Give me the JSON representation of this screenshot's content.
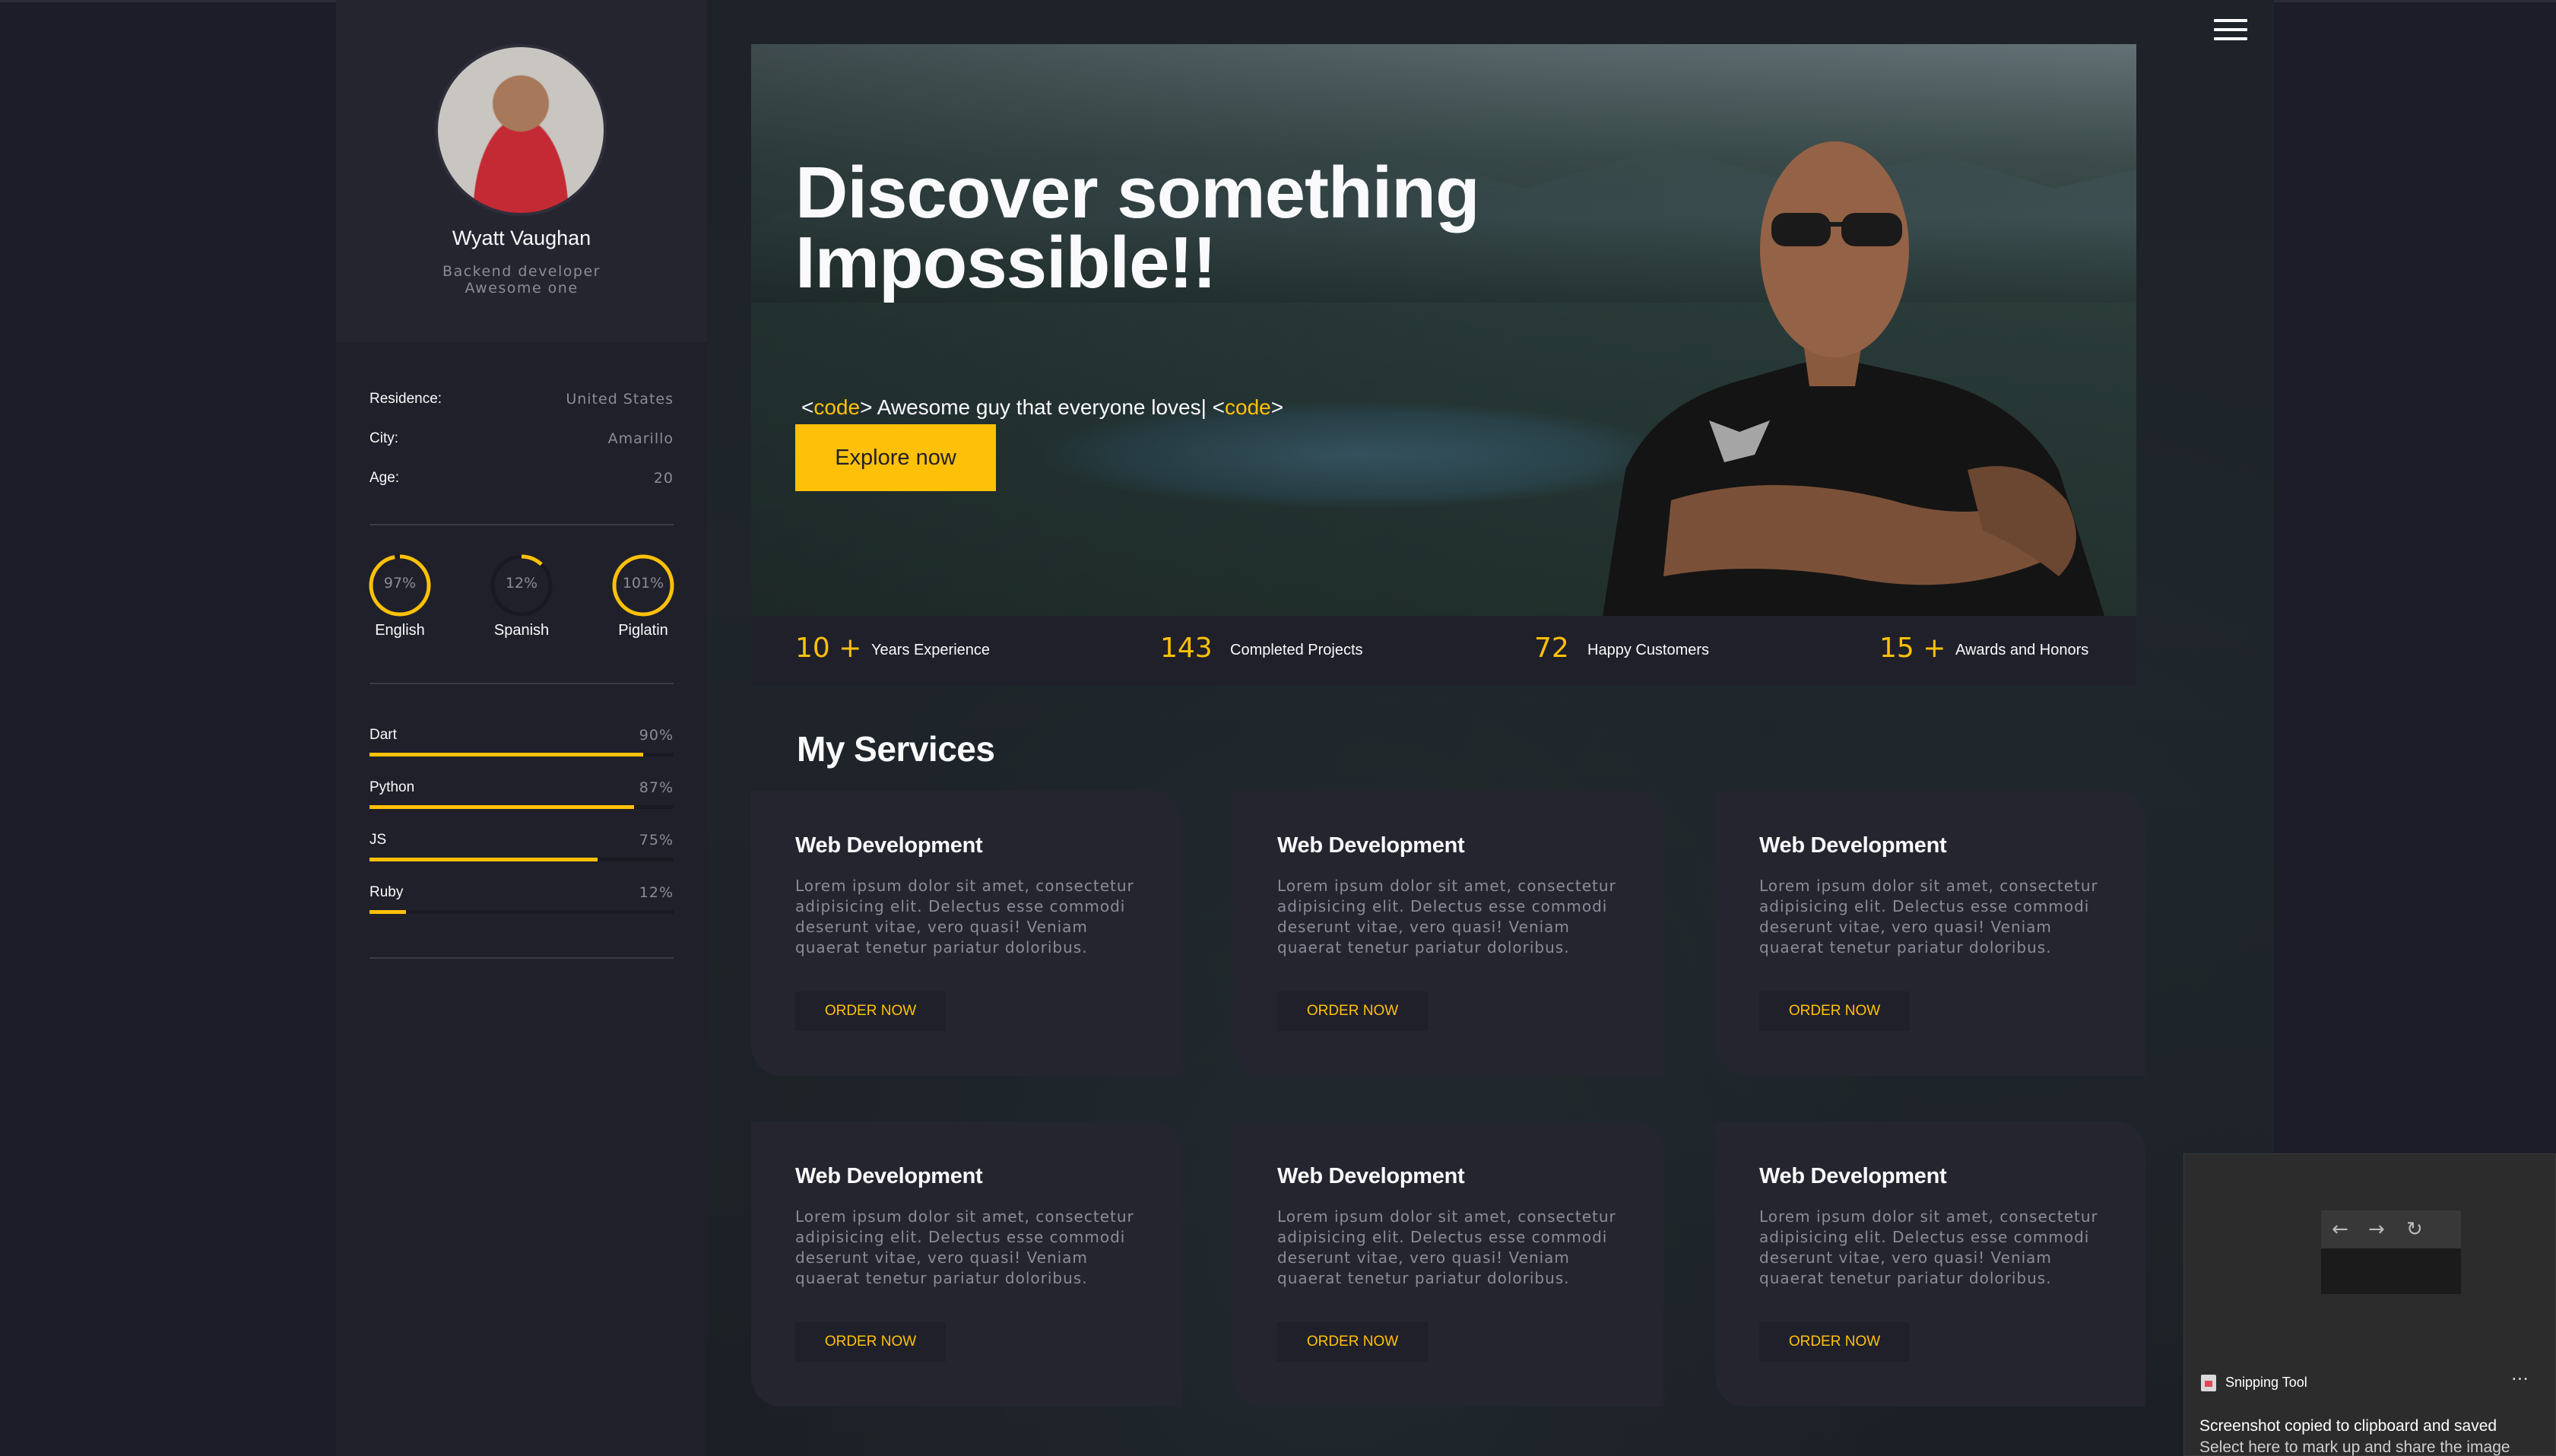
{
  "sidebar": {
    "profile": {
      "name": "Wyatt Vaughan",
      "role_line1": "Backend developer",
      "role_line2": "Awesome one"
    },
    "info": [
      {
        "label": "Residence:",
        "value": "United States"
      },
      {
        "label": "City:",
        "value": "Amarillo"
      },
      {
        "label": "Age:",
        "value": "20"
      }
    ],
    "languages": [
      {
        "name": "English",
        "percent_label": "97%",
        "level": 0.97
      },
      {
        "name": "Spanish",
        "percent_label": "12%",
        "level": 0.12
      },
      {
        "name": "Piglatin",
        "percent_label": "101%",
        "level": 1.01
      }
    ],
    "skills": [
      {
        "name": "Dart",
        "percent_label": "90%",
        "level": 0.9
      },
      {
        "name": "Python",
        "percent_label": "87%",
        "level": 0.87
      },
      {
        "name": "JS",
        "percent_label": "75%",
        "level": 0.75
      },
      {
        "name": "Ruby",
        "percent_label": "12%",
        "level": 0.12
      }
    ]
  },
  "hero": {
    "title_line1": "Discover something",
    "title_line2": "Impossible!!",
    "subtitle_open_bracket_left": "<",
    "subtitle_tag": "code",
    "subtitle_open_bracket_right": ">",
    "subtitle_text": " Awesome guy that everyone loves| ",
    "subtitle_close_bracket_left": "<",
    "subtitle_close_bracket_right": ">",
    "button_label": "Explore now"
  },
  "counters": [
    {
      "number": "10 +",
      "label": "Years Experience"
    },
    {
      "number": "143",
      "label": "Completed Projects"
    },
    {
      "number": "72",
      "label": "Happy Customers"
    },
    {
      "number": "15 +",
      "label": "Awards and Honors"
    }
  ],
  "services": {
    "title": "My Services",
    "cards": [
      {
        "title": "Web Development",
        "description": "Lorem ipsum dolor sit amet, consectetur adipisicing elit. Delectus esse commodi deserunt vitae, vero quasi! Veniam quaerat tenetur pariatur doloribus.",
        "button": "ORDER NOW"
      },
      {
        "title": "Web Development",
        "description": "Lorem ipsum dolor sit amet, consectetur adipisicing elit. Delectus esse commodi deserunt vitae, vero quasi! Veniam quaerat tenetur pariatur doloribus.",
        "button": "ORDER NOW"
      },
      {
        "title": "Web Development",
        "description": "Lorem ipsum dolor sit amet, consectetur adipisicing elit. Delectus esse commodi deserunt vitae, vero quasi! Veniam quaerat tenetur pariatur doloribus.",
        "button": "ORDER NOW"
      },
      {
        "title": "Web Development",
        "description": "Lorem ipsum dolor sit amet, consectetur adipisicing elit. Delectus esse commodi deserunt vitae, vero quasi! Veniam quaerat tenetur pariatur doloribus.",
        "button": "ORDER NOW"
      },
      {
        "title": "Web Development",
        "description": "Lorem ipsum dolor sit amet, consectetur adipisicing elit. Delectus esse commodi deserunt vitae, vero quasi! Veniam quaerat tenetur pariatur doloribus.",
        "button": "ORDER NOW"
      },
      {
        "title": "Web Development",
        "description": "Lorem ipsum dolor sit amet, consectetur adipisicing elit. Delectus esse commodi deserunt vitae, vero quasi! Veniam quaerat tenetur pariatur doloribus.",
        "button": "ORDER NOW"
      }
    ]
  },
  "menu": {
    "icon": "hamburger-menu-icon"
  },
  "toast": {
    "app_name": "Snipping Tool",
    "more": "···",
    "line1": "Screenshot copied to clipboard and saved",
    "line2": "Select here to mark up and share the image",
    "thumb_back": "←",
    "thumb_forward": "→",
    "thumb_reload": "↻"
  },
  "colors": {
    "accent": "#ffc107",
    "background": "#1e1e29",
    "sidebar": "#20202a",
    "card": "#252530",
    "muted_text": "#8c8c99",
    "text": "#fafafc"
  }
}
